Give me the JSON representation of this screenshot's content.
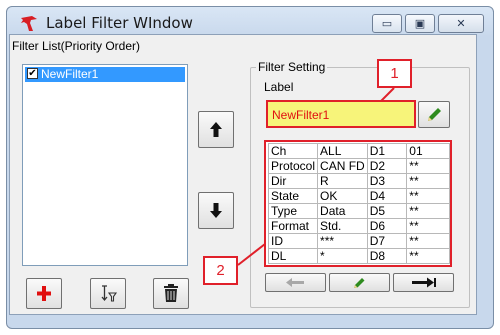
{
  "window": {
    "title": "Label Filter WIndow"
  },
  "caption_buttons": {
    "minimize": "▭",
    "maximize": "▣",
    "close": "✕"
  },
  "filter_list": {
    "label": "Filter List(Priority Order)",
    "items": [
      {
        "name": "NewFilter1",
        "checked": true,
        "selected": true
      }
    ]
  },
  "filter_setting": {
    "group_label": "Filter Setting",
    "label_caption": "Label",
    "label_value": "NewFilter1",
    "rows": [
      [
        "Ch",
        "ALL",
        "D1",
        "01"
      ],
      [
        "Protocol",
        "CAN FD",
        "D2",
        "**"
      ],
      [
        "Dir",
        "R",
        "D3",
        "**"
      ],
      [
        "State",
        "OK",
        "D4",
        "**"
      ],
      [
        "Type",
        "Data",
        "D5",
        "**"
      ],
      [
        "Format",
        "Std.",
        "D6",
        "**"
      ],
      [
        "ID",
        "***",
        "D7",
        "**"
      ],
      [
        "DL",
        "*",
        "D8",
        "**"
      ]
    ]
  },
  "callouts": {
    "one": "1",
    "two": "2"
  },
  "colors": {
    "selection": "#3399ff",
    "highlight_red": "#e0202a",
    "label_bg": "#f7f47a",
    "add_icon": "#e01010",
    "pencil": "#2e8b1e"
  },
  "icons": {
    "app": "red-bird-icon",
    "add": "plus-icon",
    "sort": "sort-filter-icon",
    "delete": "trash-icon",
    "up": "arrow-up-icon",
    "down": "arrow-down-icon",
    "edit": "pencil-icon",
    "prev": "arrow-left-icon",
    "next": "arrow-right-icon"
  }
}
